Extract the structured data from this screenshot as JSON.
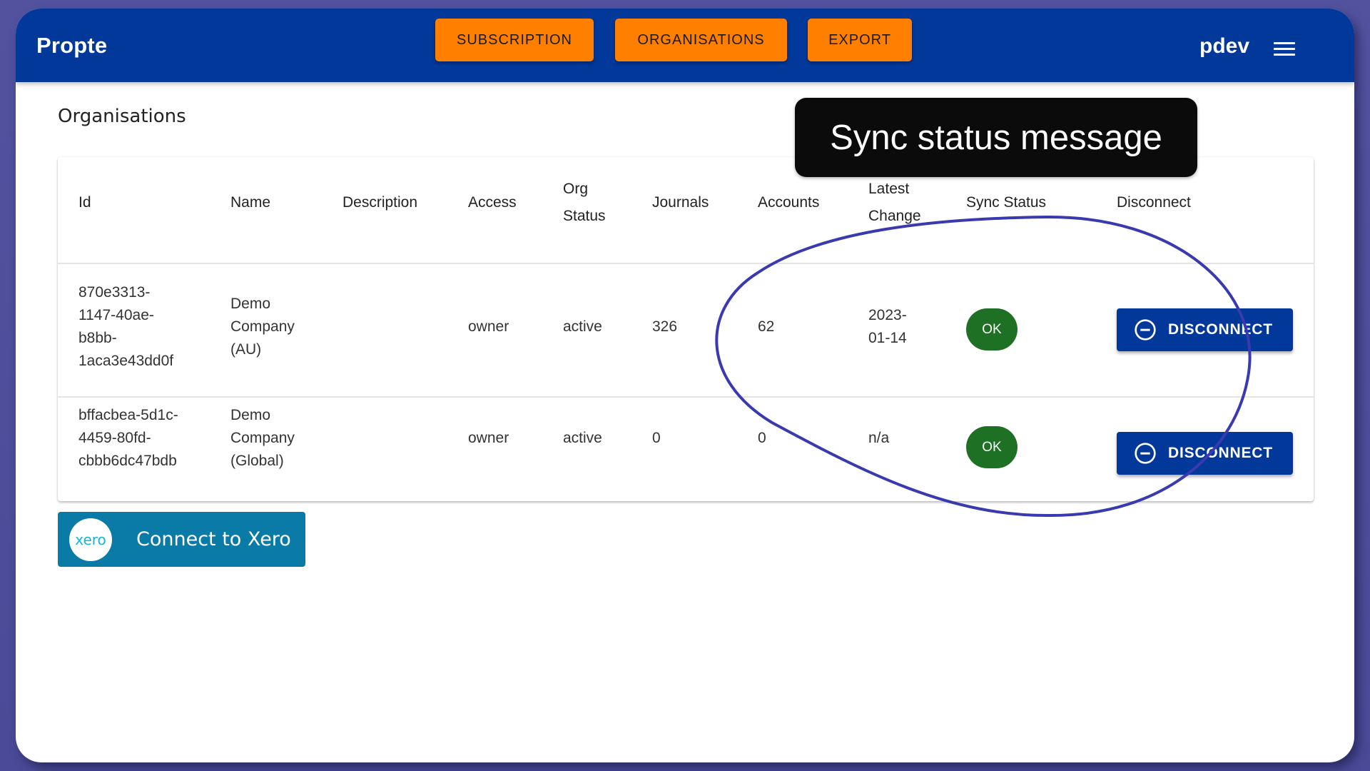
{
  "app": {
    "brand": "Propte",
    "user": "pdev",
    "menu_icon": "hamburger-menu-icon"
  },
  "nav": {
    "subscription": "SUBSCRIPTION",
    "organisations": "ORGANISATIONS",
    "export": "EXPORT"
  },
  "colors": {
    "appbar": "#02389a",
    "nav_button": "#ff7f00",
    "status_ok": "#1e7024",
    "disconnect_button": "#02389a",
    "xero_button": "#0a7aa6",
    "annotation_stroke": "#3a3ab0"
  },
  "page": {
    "title": "Organisations"
  },
  "table": {
    "headers": {
      "id": "Id",
      "name": "Name",
      "description": "Description",
      "access": "Access",
      "org_status_1": "Org",
      "org_status_2": "Status",
      "journals": "Journals",
      "accounts": "Accounts",
      "latest_change_1": "Latest",
      "latest_change_2": "Change",
      "sync_status": "Sync Status",
      "disconnect": "Disconnect"
    },
    "rows": [
      {
        "id_lines": [
          "870e3313-",
          "1147-40ae-",
          "b8bb-",
          "1aca3e43dd0f"
        ],
        "name_lines": [
          "Demo",
          "Company",
          "(AU)"
        ],
        "description": "",
        "access": "owner",
        "org_status": "active",
        "journals": "326",
        "accounts": "62",
        "latest_change_lines": [
          "2023-",
          "01-14"
        ],
        "sync_status": "OK",
        "disconnect_label": "DISCONNECT"
      },
      {
        "id_lines": [
          "bffacbea-5d1c-",
          "4459-80fd-",
          "cbbb6dc47bdb"
        ],
        "name_lines": [
          "Demo",
          "Company",
          "(Global)"
        ],
        "description": "",
        "access": "owner",
        "org_status": "active",
        "journals": "0",
        "accounts": "0",
        "latest_change_lines": [
          "n/a"
        ],
        "sync_status": "OK",
        "disconnect_label": "DISCONNECT"
      }
    ]
  },
  "xero": {
    "logo_text": "xero",
    "label": "Connect to Xero"
  },
  "tooltip": {
    "text": "Sync status message"
  }
}
